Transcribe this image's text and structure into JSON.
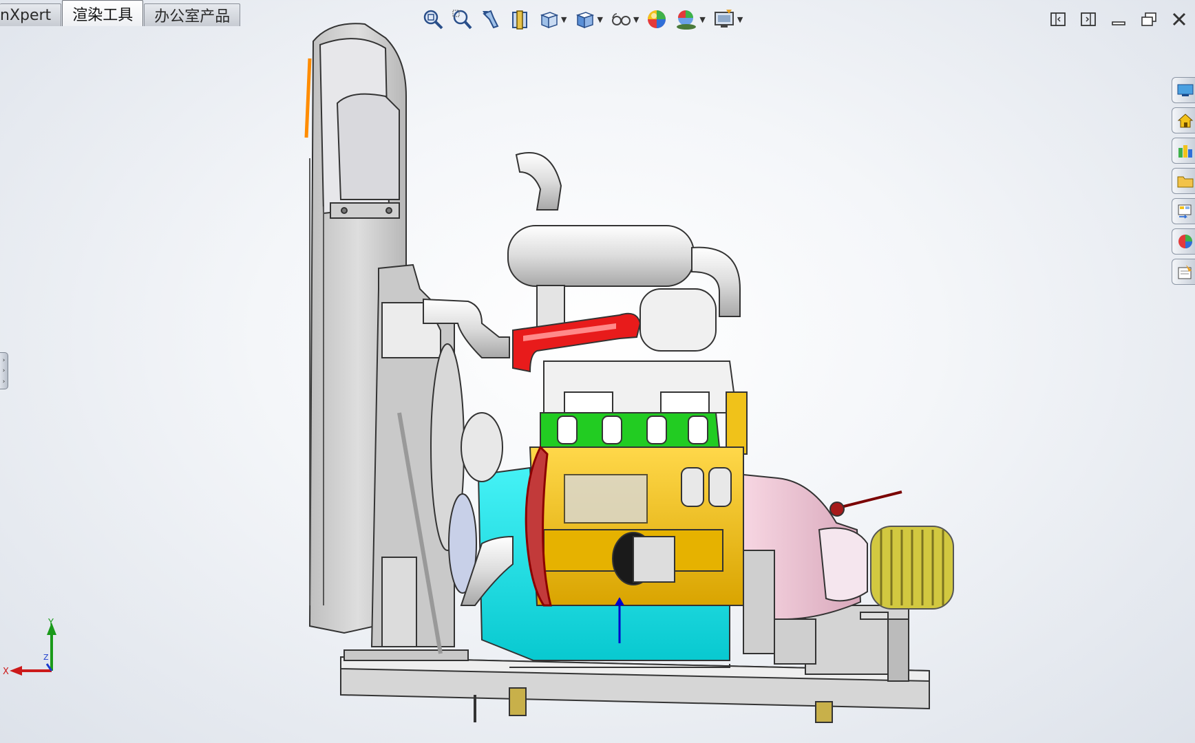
{
  "tabs": [
    {
      "label": "nXpert",
      "active": false
    },
    {
      "label": "渲染工具",
      "active": true
    },
    {
      "label": "办公室产品",
      "active": false
    }
  ],
  "view_toolbar": [
    {
      "icon": "zoom-to-fit-icon"
    },
    {
      "icon": "zoom-to-area-icon"
    },
    {
      "icon": "previous-view-icon"
    },
    {
      "icon": "section-view-icon"
    },
    {
      "icon": "view-orientation-icon"
    },
    {
      "icon": "display-style-icon"
    },
    {
      "icon": "hide-show-items-icon"
    },
    {
      "icon": "edit-appearance-icon"
    },
    {
      "icon": "apply-scene-icon"
    },
    {
      "icon": "view-settings-icon"
    }
  ],
  "window_controls": [
    "tile-left-icon",
    "tile-right-icon",
    "minimize-icon",
    "restore-icon",
    "close-icon"
  ],
  "task_pane": [
    {
      "icon": "solidworks-resources-icon"
    },
    {
      "icon": "home-icon"
    },
    {
      "icon": "design-library-icon"
    },
    {
      "icon": "file-explorer-icon"
    },
    {
      "icon": "view-palette-icon"
    },
    {
      "icon": "appearances-scenes-icon"
    },
    {
      "icon": "custom-properties-icon"
    }
  ],
  "triad": {
    "x_label": "X",
    "y_label": "Y",
    "z_label": "Z"
  },
  "colors": {
    "background_center": "#ffffff",
    "background_edge": "#dde2ea",
    "engine_block": "#f0c21a",
    "oil_pan": "#19e0e6",
    "manifold_highlight": "#e81b1b",
    "valve_cover_band": "#22cc22",
    "flywheel_housing": "#f2c6d6",
    "coupling": "#cfc63a",
    "radiator": "#d0d0d0"
  }
}
